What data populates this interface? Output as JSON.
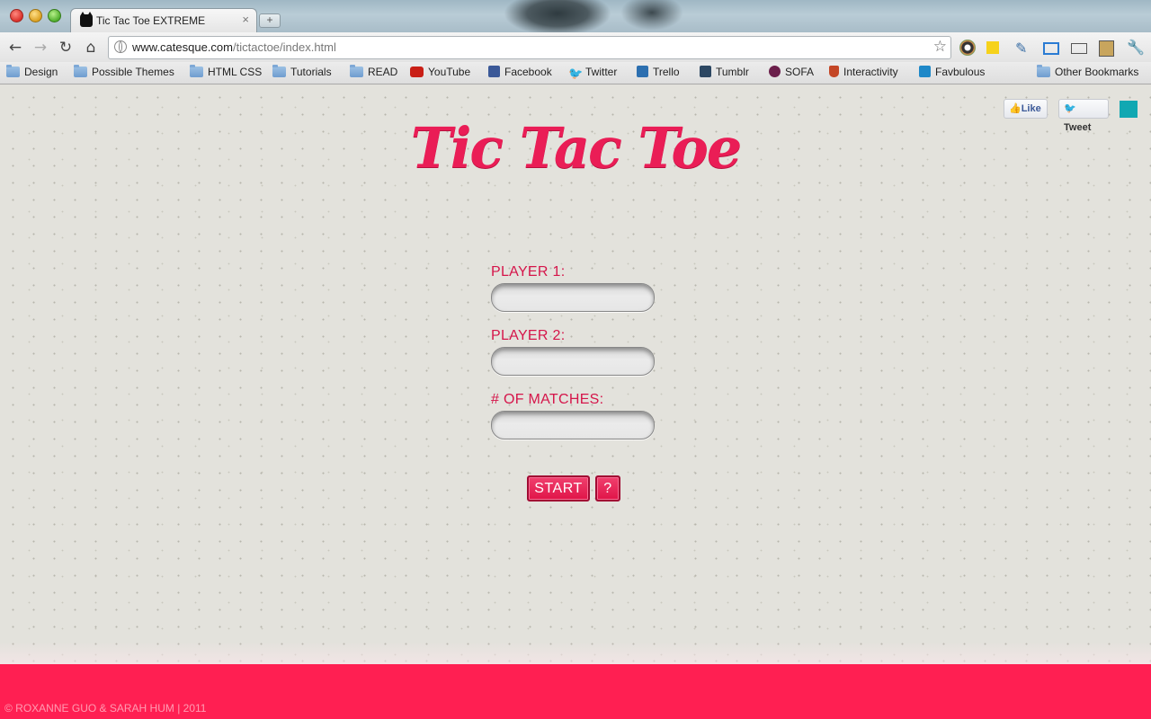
{
  "browser": {
    "tab_title": "Tic Tac Toe EXTREME",
    "tab_close": "×",
    "new_tab": "+",
    "url_domain": "www.catesque.com",
    "url_path": "/tictactoe/index.html",
    "nav": {
      "back": "←",
      "forward": "→",
      "reload": "↻",
      "home": "⌂"
    },
    "star": "☆",
    "extension_icons": [
      "color-picker-icon",
      "sticky-note-icon",
      "pen-icon",
      "screen-capture-icon",
      "window-icon",
      "scrapbook-icon",
      "wrench-icon"
    ],
    "bookmarks": [
      {
        "label": "Design",
        "icon": "folder-icon"
      },
      {
        "label": "Possible Themes",
        "icon": "folder-icon"
      },
      {
        "label": "HTML CSS",
        "icon": "folder-icon"
      },
      {
        "label": "Tutorials",
        "icon": "folder-icon"
      },
      {
        "label": "READ",
        "icon": "folder-icon"
      },
      {
        "label": "YouTube",
        "icon": "youtube-icon"
      },
      {
        "label": "Facebook",
        "icon": "facebook-icon"
      },
      {
        "label": "Twitter",
        "icon": "twitter-icon"
      },
      {
        "label": "Trello",
        "icon": "trello-icon"
      },
      {
        "label": "Tumblr",
        "icon": "tumblr-icon"
      },
      {
        "label": "SOFA",
        "icon": "sofa-icon"
      },
      {
        "label": "Interactivity",
        "icon": "plant-icon"
      },
      {
        "label": "Favbulous",
        "icon": "favbulous-icon"
      }
    ],
    "other_bookmarks": "Other Bookmarks"
  },
  "page": {
    "social": {
      "like": "Like",
      "tweet": "Tweet",
      "accent_color": "#11a8b2"
    },
    "title": "Tic Tac Toe",
    "form": {
      "player1_label": "PLAYER 1:",
      "player1_value": "",
      "player2_label": "PLAYER 2:",
      "player2_value": "",
      "matches_label": "# OF MATCHES:",
      "matches_value": ""
    },
    "buttons": {
      "start": "START",
      "help": "?"
    },
    "footer": {
      "credits": "© ROXANNE GUO & SARAH HUM | 2011"
    },
    "colors": {
      "brand_pink": "#ff1f52",
      "label_red": "#d5154a",
      "title_pink": "#ea1d56"
    }
  }
}
